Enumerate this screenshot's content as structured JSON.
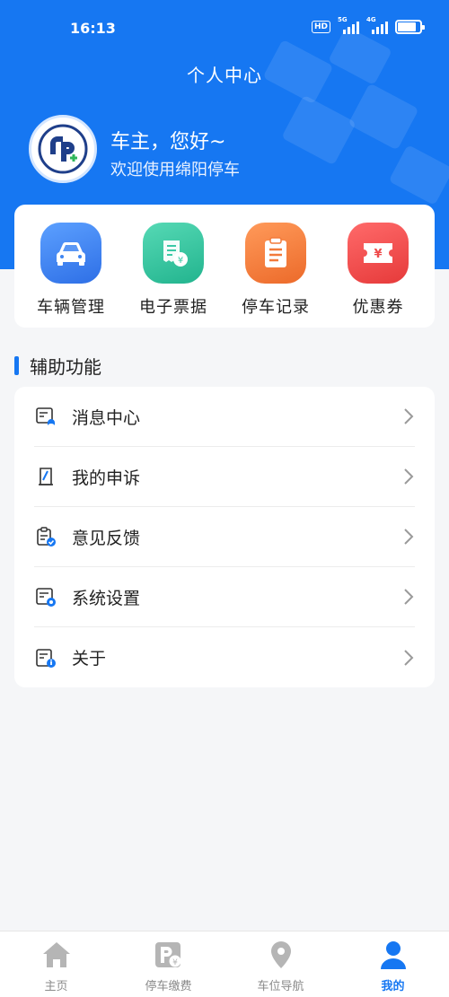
{
  "status_bar": {
    "time": "16:13",
    "hd": "HD",
    "net1": "5G",
    "net2": "4G",
    "battery_level": 0.85
  },
  "header": {
    "title": "个人中心",
    "greeting": "车主，您好~",
    "welcome": "欢迎使用绵阳停车",
    "bg_color": "#1677f2"
  },
  "quick_actions": [
    {
      "label": "车辆管理",
      "icon": "car-icon",
      "color": "#3f86f2"
    },
    {
      "label": "电子票据",
      "icon": "receipt-icon",
      "color": "#3cc9a6"
    },
    {
      "label": "停车记录",
      "icon": "clipboard-icon",
      "color": "#f27a3a"
    },
    {
      "label": "优惠券",
      "icon": "coupon-icon",
      "color": "#ef4b4b"
    }
  ],
  "aux": {
    "title": "辅助功能",
    "items": [
      {
        "label": "消息中心",
        "icon": "message-center-icon"
      },
      {
        "label": "我的申诉",
        "icon": "appeal-icon"
      },
      {
        "label": "意见反馈",
        "icon": "feedback-icon"
      },
      {
        "label": "系统设置",
        "icon": "settings-icon"
      },
      {
        "label": "关于",
        "icon": "about-icon"
      }
    ]
  },
  "tabbar": {
    "items": [
      {
        "label": "主页",
        "icon": "home-icon",
        "active": false
      },
      {
        "label": "停车缴费",
        "icon": "parking-pay-icon",
        "active": false
      },
      {
        "label": "车位导航",
        "icon": "location-pin-icon",
        "active": false
      },
      {
        "label": "我的",
        "icon": "user-icon",
        "active": true
      }
    ],
    "active_color": "#1677f2",
    "inactive_color": "#b5b5b5"
  }
}
